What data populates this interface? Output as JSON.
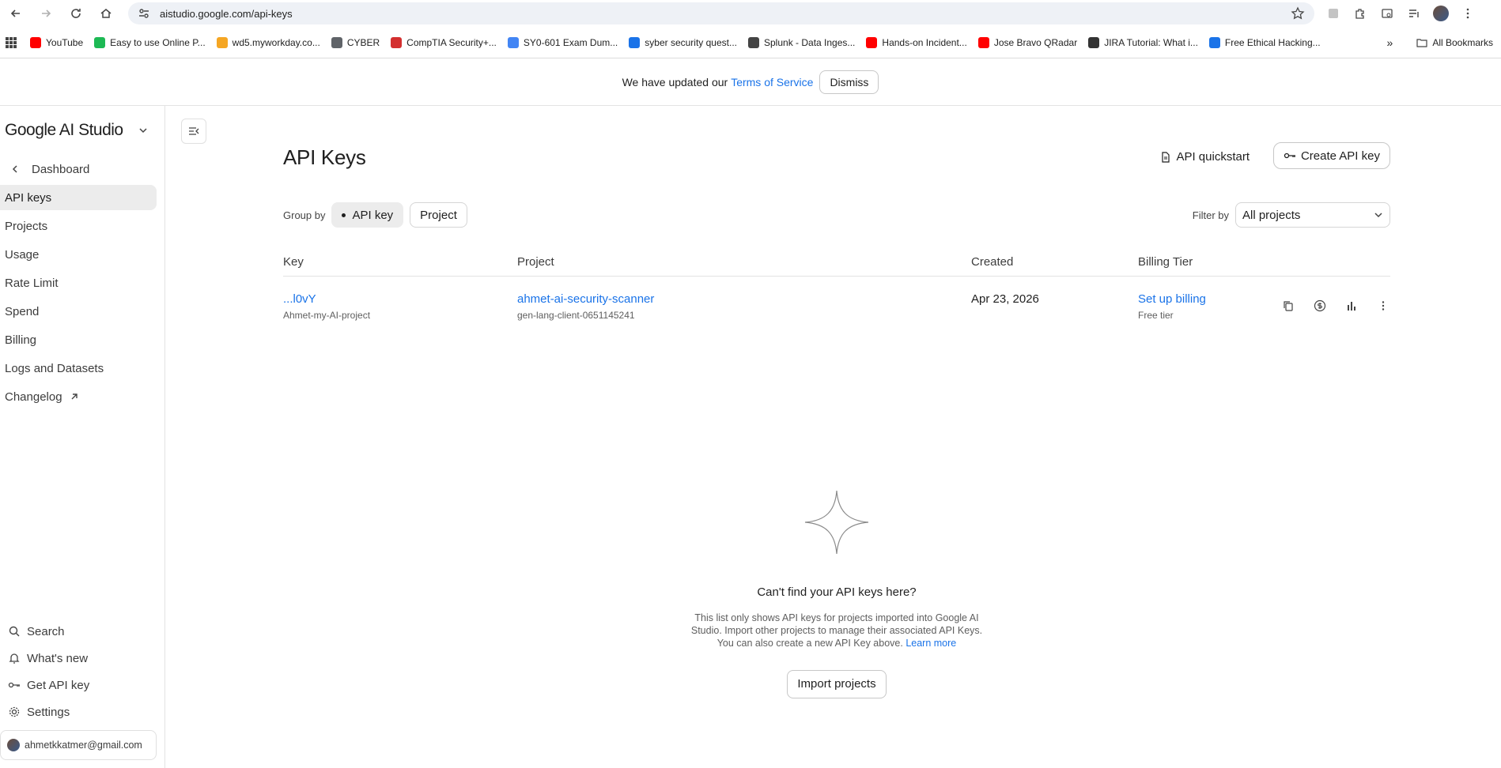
{
  "browser": {
    "url": "aistudio.google.com/api-keys",
    "bookmarks": [
      {
        "label": "YouTube",
        "color": "#ff0000"
      },
      {
        "label": "Easy to use Online P...",
        "color": "#1db954"
      },
      {
        "label": "wd5.myworkday.co...",
        "color": "#f5a623"
      },
      {
        "label": "CYBER",
        "color": "#5f6368"
      },
      {
        "label": "CompTIA Security+...",
        "color": "#d32f2f"
      },
      {
        "label": "SY0-601 Exam Dum...",
        "color": "#4285f4"
      },
      {
        "label": "syber security quest...",
        "color": "#1a73e8"
      },
      {
        "label": "Splunk - Data Inges...",
        "color": "#444444"
      },
      {
        "label": "Hands-on Incident...",
        "color": "#ff0000"
      },
      {
        "label": "Jose Bravo QRadar",
        "color": "#ff0000"
      },
      {
        "label": "JIRA Tutorial: What i...",
        "color": "#333333"
      },
      {
        "label": "Free Ethical Hacking...",
        "color": "#1a73e8"
      }
    ],
    "all_bookmarks": "All Bookmarks"
  },
  "banner": {
    "text": "We have updated our",
    "link": "Terms of Service",
    "dismiss": "Dismiss"
  },
  "sidebar": {
    "brand": "Google AI Studio",
    "back": "Dashboard",
    "items": [
      {
        "label": "API keys",
        "active": true
      },
      {
        "label": "Projects"
      },
      {
        "label": "Usage"
      },
      {
        "label": "Rate Limit"
      },
      {
        "label": "Spend"
      },
      {
        "label": "Billing"
      },
      {
        "label": "Logs and Datasets"
      },
      {
        "label": "Changelog"
      }
    ],
    "bottom": {
      "search": "Search",
      "whats_new": "What's new",
      "get_api_key": "Get API key",
      "settings": "Settings",
      "account": "ahmetkkatmer@gmail.com"
    }
  },
  "main": {
    "title": "API Keys",
    "quickstart": "API quickstart",
    "create": "Create API key",
    "group_by": "Group by",
    "group_options": [
      "API key",
      "Project"
    ],
    "filter_by": "Filter by",
    "filter_value": "All projects",
    "columns": [
      "Key",
      "Project",
      "Created",
      "Billing Tier"
    ],
    "rows": [
      {
        "key": "...l0vY",
        "key_name": "Ahmet-my-AI-project",
        "project": "ahmet-ai-security-scanner",
        "project_id": "gen-lang-client-0651145241",
        "created": "Apr 23, 2026",
        "billing": "Set up billing",
        "tier": "Free tier"
      }
    ],
    "empty": {
      "title": "Can't find your API keys here?",
      "text": "This list only shows API keys for projects imported into Google AI Studio. Import other projects to manage their associated API Keys. You can also create a new API Key above.",
      "learn_more": "Learn more",
      "import": "Import projects"
    }
  }
}
